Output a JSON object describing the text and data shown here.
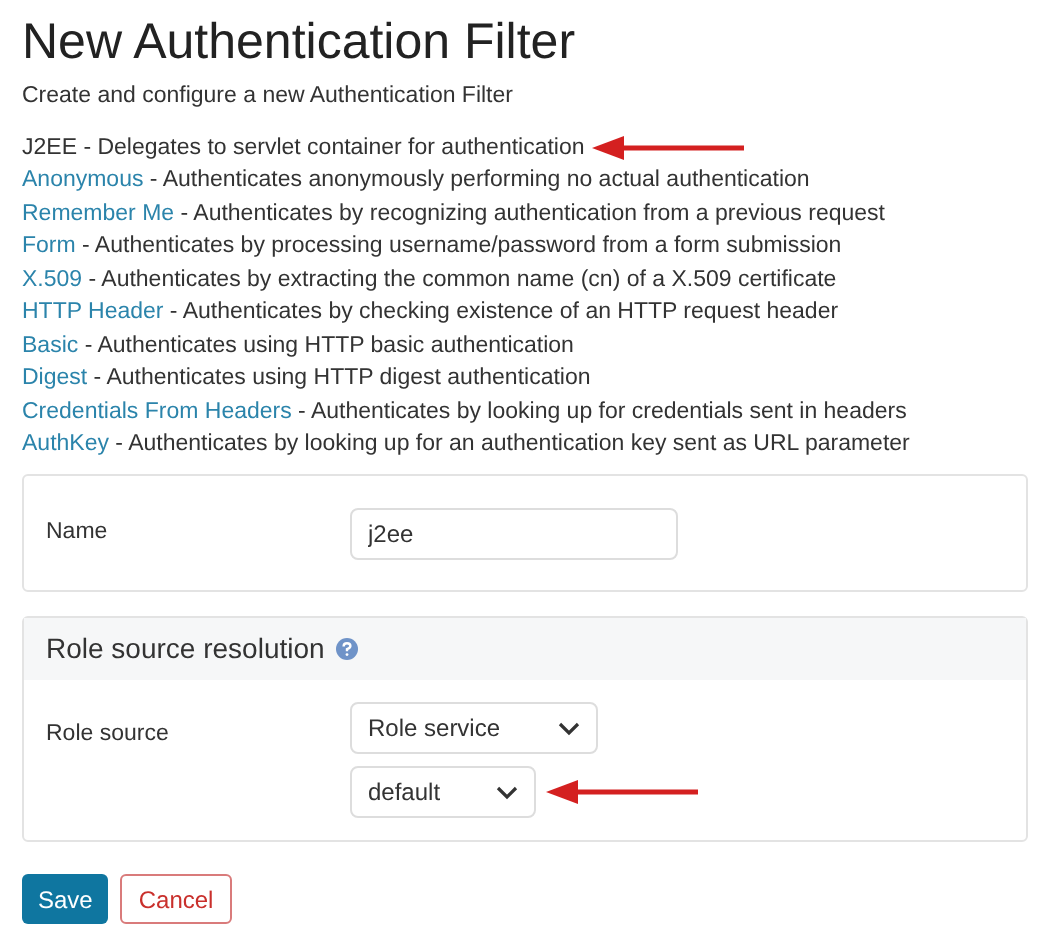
{
  "title": "New Authentication Filter",
  "subtitle": "Create and configure a new Authentication Filter",
  "filter_types": [
    {
      "name": "J2EE",
      "description": " - Delegates to servlet container for authentication",
      "selected": true
    },
    {
      "name": "Anonymous",
      "description": " - Authenticates anonymously performing no actual authentication",
      "selected": false
    },
    {
      "name": "Remember Me",
      "description": " - Authenticates by recognizing authentication from a previous request",
      "selected": false
    },
    {
      "name": "Form",
      "description": " - Authenticates by processing username/password from a form submission",
      "selected": false
    },
    {
      "name": "X.509",
      "description": " - Authenticates by extracting the common name (cn) of a X.509 certificate",
      "selected": false
    },
    {
      "name": "HTTP Header",
      "description": " - Authenticates by checking existence of an HTTP request header",
      "selected": false
    },
    {
      "name": "Basic",
      "description": " - Authenticates using HTTP basic authentication",
      "selected": false
    },
    {
      "name": "Digest",
      "description": " - Authenticates using HTTP digest authentication",
      "selected": false
    },
    {
      "name": "Credentials From Headers",
      "description": " - Authenticates by looking up for credentials sent in headers",
      "selected": false
    },
    {
      "name": "AuthKey",
      "description": " - Authenticates by looking up for an authentication key sent as URL parameter",
      "selected": false
    }
  ],
  "name_field": {
    "label": "Name",
    "value": "j2ee"
  },
  "role_panel": {
    "title": "Role source resolution",
    "role_source_label": "Role source",
    "role_source": "Role service",
    "role_service": "default"
  },
  "buttons": {
    "save": "Save",
    "cancel": "Cancel"
  }
}
